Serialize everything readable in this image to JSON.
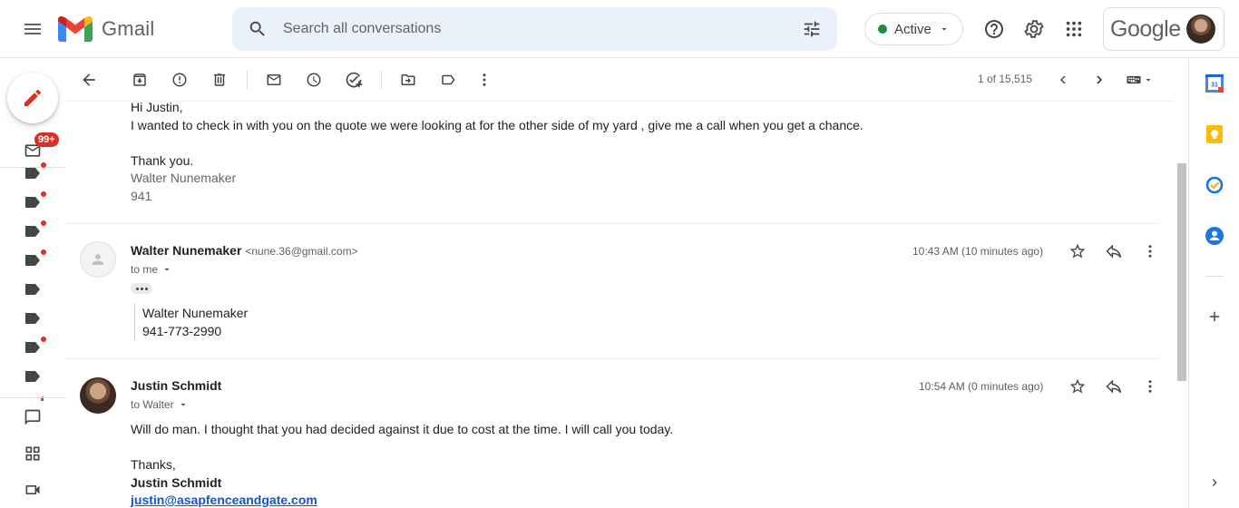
{
  "header": {
    "app_name": "Gmail",
    "search_placeholder": "Search all conversations",
    "status_label": "Active",
    "account_brand": "Google"
  },
  "rail": {
    "inbox_badge": "99+"
  },
  "toolbar": {
    "pager": "1 of 15,515"
  },
  "thread": {
    "first_message": {
      "greeting": "Hi Justin,",
      "body": "I wanted to check in with you on the quote we were looking at for the other side of my yard , give me a call when you get a chance.",
      "closing": "Thank you.",
      "sig_name": "Walter Nunemaker",
      "sig_phone": "941"
    },
    "second_message": {
      "sender_name": "Walter Nunemaker",
      "sender_email": "<nune.36@gmail.com>",
      "to": "to me",
      "time": "10:43 AM (10 minutes ago)",
      "quote_name": "Walter Nunemaker",
      "quote_phone": "941-773-2990"
    },
    "third_message": {
      "sender_name": "Justin Schmidt",
      "to": "to Walter",
      "time": "10:54 AM (0 minutes ago)",
      "body": "Will do man. I thought that you had decided against it due to cost at the time. I will call you today.",
      "closing": "Thanks,",
      "sig_name": "Justin Schmidt",
      "sig_email": "justin@asapfenceandgate.com"
    }
  },
  "colors": {
    "accent_red": "#d93025",
    "link_blue": "#1155cc",
    "status_green": "#1e8e3e",
    "search_bg": "#eaf1fb"
  }
}
